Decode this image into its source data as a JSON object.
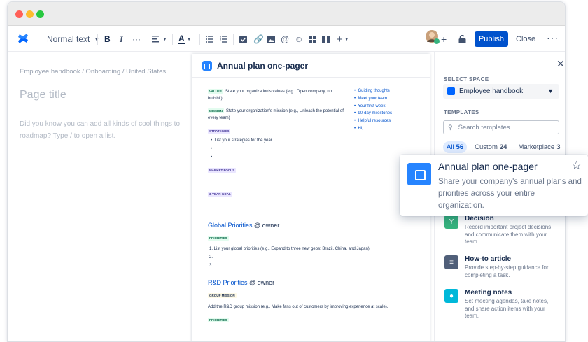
{
  "toolbar": {
    "text_style": "Normal text",
    "bold": "B",
    "italic": "I",
    "more_format": "···",
    "insert": "+",
    "publish": "Publish",
    "close": "Close",
    "more": "···"
  },
  "editor": {
    "breadcrumb": "Employee handbook  /  Onboarding / United States",
    "title_placeholder": "Page title",
    "hint": "Did you know you can add all kinds of cool things to roadmap? Type / to open a list."
  },
  "preview": {
    "title": "Annual plan one-pager",
    "values_tag": "VALUES",
    "values_text": "State your organization's values (e.g., Open company, no bullshit)",
    "mission_tag": "MISSION",
    "mission_text": "State your organization's mission (e.g., Unleash the potential of every team)",
    "strategies_tag": "STRATEGIES",
    "strategy_item": "List your strategies for the year.",
    "market_tag": "MARKET FOCUS",
    "goal_tag": "3-YEAR GOAL",
    "global_heading": "Global Priorities",
    "owner": "@ owner",
    "priorities_tag": "PRIORITIES",
    "global_item1": "1. List your global priorities (e.g., Expand to three new geos: Brazil, China, and Japan)",
    "global_item2": "2.",
    "global_item3": "3.",
    "rd_heading": "R&D Priorities",
    "group_mission_tag": "GROUP MISSION",
    "rd_text": "Add the R&D group mission (e.g., Make fans out of customers by improving experience at scale).",
    "rd_priorities_tag": "PRIORITIES",
    "links": [
      "Guiding thoughts",
      "Meet your team",
      "Your first week",
      "90-day milestones",
      "Helpful resources",
      "Hi,"
    ]
  },
  "sidebar": {
    "select_space_label": "SELECT SPACE",
    "space": "Employee handbook",
    "templates_label": "TEMPLATES",
    "search_placeholder": "Search templates",
    "filters": [
      {
        "label": "All",
        "count": "56"
      },
      {
        "label": "Custom",
        "count": "24"
      },
      {
        "label": "Marketplace",
        "count": "3"
      }
    ],
    "templates": [
      {
        "name": "Decision",
        "desc": "Record important project decisions and communicate them with your team.",
        "icon": "decision-icon",
        "color": "#36b37e"
      },
      {
        "name": "How-to article",
        "desc": "Provide step-by-step guidance for completing a task.",
        "icon": "list-icon",
        "color": "#505f79"
      },
      {
        "name": "Meeting notes",
        "desc": "Set meeting agendas, take notes, and share action items with your team.",
        "icon": "people-icon",
        "color": "#00b8d9"
      }
    ]
  },
  "popover": {
    "title": "Annual plan one-pager",
    "desc": "Share your company's annual plans and priorities across your entire organization.",
    "icon": "annual-plan-icon",
    "star_icon": "star-icon"
  },
  "colors": {
    "accent": "#0052cc",
    "logo": "#0065ff"
  }
}
